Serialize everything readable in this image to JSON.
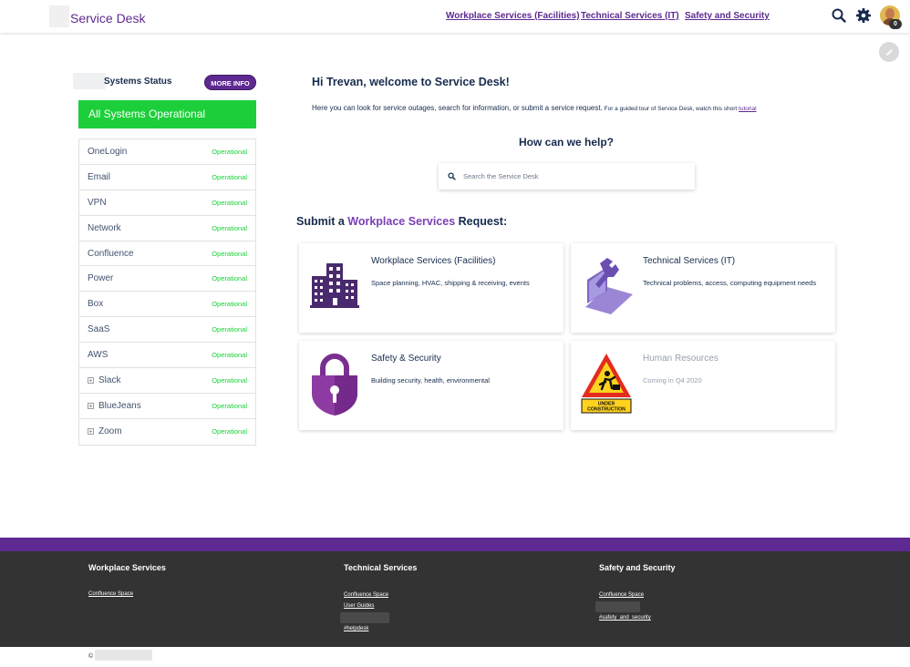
{
  "header": {
    "brand": "Service Desk",
    "nav": [
      {
        "label": "Workplace Services (Facilities)"
      },
      {
        "label": "Technical Services (IT)"
      },
      {
        "label": "Safety and Security"
      }
    ],
    "notification_count": "0"
  },
  "sidebar": {
    "title": "Systems Status",
    "more_info": "MORE INFO",
    "overall": "All Systems Operational",
    "systems": [
      {
        "name": "OneLogin",
        "status": "Operational"
      },
      {
        "name": "Email",
        "status": "Operational"
      },
      {
        "name": "VPN",
        "status": "Operational"
      },
      {
        "name": "Network",
        "status": "Operational"
      },
      {
        "name": "Confluence",
        "status": "Operational"
      },
      {
        "name": "Power",
        "status": "Operational"
      },
      {
        "name": "Box",
        "status": "Operational"
      },
      {
        "name": "SaaS",
        "status": "Operational"
      },
      {
        "name": "AWS",
        "status": "Operational"
      },
      {
        "name": "Slack",
        "status": "Operational"
      },
      {
        "name": "BlueJeans",
        "status": "Operational"
      },
      {
        "name": "Zoom",
        "status": "Operational"
      }
    ]
  },
  "main": {
    "welcome": "Hi Trevan, welcome to Service Desk!",
    "intro_text": "Here you can look for service outages, search for information, or submit a service request.",
    "intro_small": " For a guided tour of Service Desk, watch this short ",
    "intro_link": "tutorial",
    "help_title": "How can we help?",
    "search_placeholder": "Search the Service Desk",
    "submit_prefix": "Submit a ",
    "submit_accent": "Workplace Services",
    "submit_suffix": " Request:",
    "cards": [
      {
        "title": "Workplace Services (Facilities)",
        "desc": "Space planning, HVAC, shipping & receiving, events"
      },
      {
        "title": "Technical Services (IT)",
        "desc": "Technical problems, access, computing equipment needs"
      },
      {
        "title": "Safety & Security",
        "desc": "Building security, health, environmental"
      },
      {
        "title": "Human Resources",
        "desc": "Coming in Q4 2020",
        "sign_line1": "UNDER",
        "sign_line2": "CONSTRUCTION"
      }
    ]
  },
  "footer": {
    "columns": [
      {
        "title": "Workplace Services",
        "links": [
          "Confluence Space"
        ]
      },
      {
        "title": "Technical Services",
        "links": [
          "Confluence Space",
          "User Guides",
          "#helpdesk"
        ]
      },
      {
        "title": "Safety and Security",
        "links": [
          "Confluence Space",
          "#safety_and_security"
        ]
      }
    ],
    "copyright": "©"
  },
  "colors": {
    "brand_purple": "#5e2a91",
    "accent_purple": "#7b3fb6",
    "status_green": "#1ccf3a",
    "footer_dark": "#333333"
  },
  "icons": [
    "search-icon",
    "gear-icon",
    "pencil-icon",
    "building-icon",
    "laptop-wrench-icon",
    "padlock-shield-icon",
    "under-construction-icon"
  ]
}
